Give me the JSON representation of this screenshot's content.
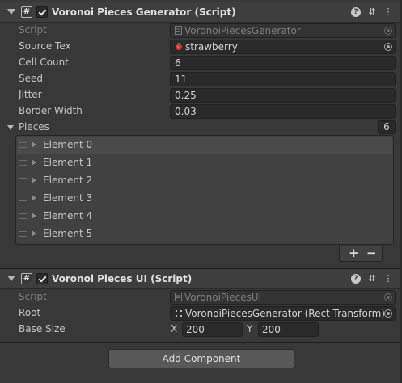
{
  "component1": {
    "title": "Voronoi Pieces Generator (Script)",
    "script_label": "Script",
    "script_value": "VoronoiPiecesGenerator",
    "fields": [
      {
        "label": "Source Tex",
        "value": "strawberry"
      },
      {
        "label": "Cell Count",
        "value": "6"
      },
      {
        "label": "Seed",
        "value": "11"
      },
      {
        "label": "Jitter",
        "value": "0.25"
      },
      {
        "label": "Border Width",
        "value": "0.03"
      }
    ],
    "pieces": {
      "label": "Pieces",
      "count": "6",
      "elements": [
        "Element 0",
        "Element 1",
        "Element 2",
        "Element 3",
        "Element 4",
        "Element 5"
      ]
    },
    "add_label": "+",
    "remove_label": "−"
  },
  "component2": {
    "title": "Voronoi Pieces UI (Script)",
    "script_label": "Script",
    "script_value": "VoronoiPiecesUI",
    "root_label": "Root",
    "root_value": "VoronoiPiecesGenerator (Rect Transform)",
    "base_size_label": "Base Size",
    "x_label": "X",
    "x_value": "200",
    "y_label": "Y",
    "y_value": "200"
  },
  "add_component_label": "Add Component",
  "colors": {
    "background": "#383838",
    "header": "#3e3e3e",
    "field": "#2a2a2a",
    "button": "#585858"
  },
  "icons": [
    "script-icon",
    "checkbox-icon",
    "help-icon",
    "presets-icon",
    "kebab-menu-icon",
    "object-picker-icon",
    "strawberry-texture-icon",
    "rect-transform-icon",
    "drag-handle-icon",
    "foldout-arrow-icon"
  ]
}
